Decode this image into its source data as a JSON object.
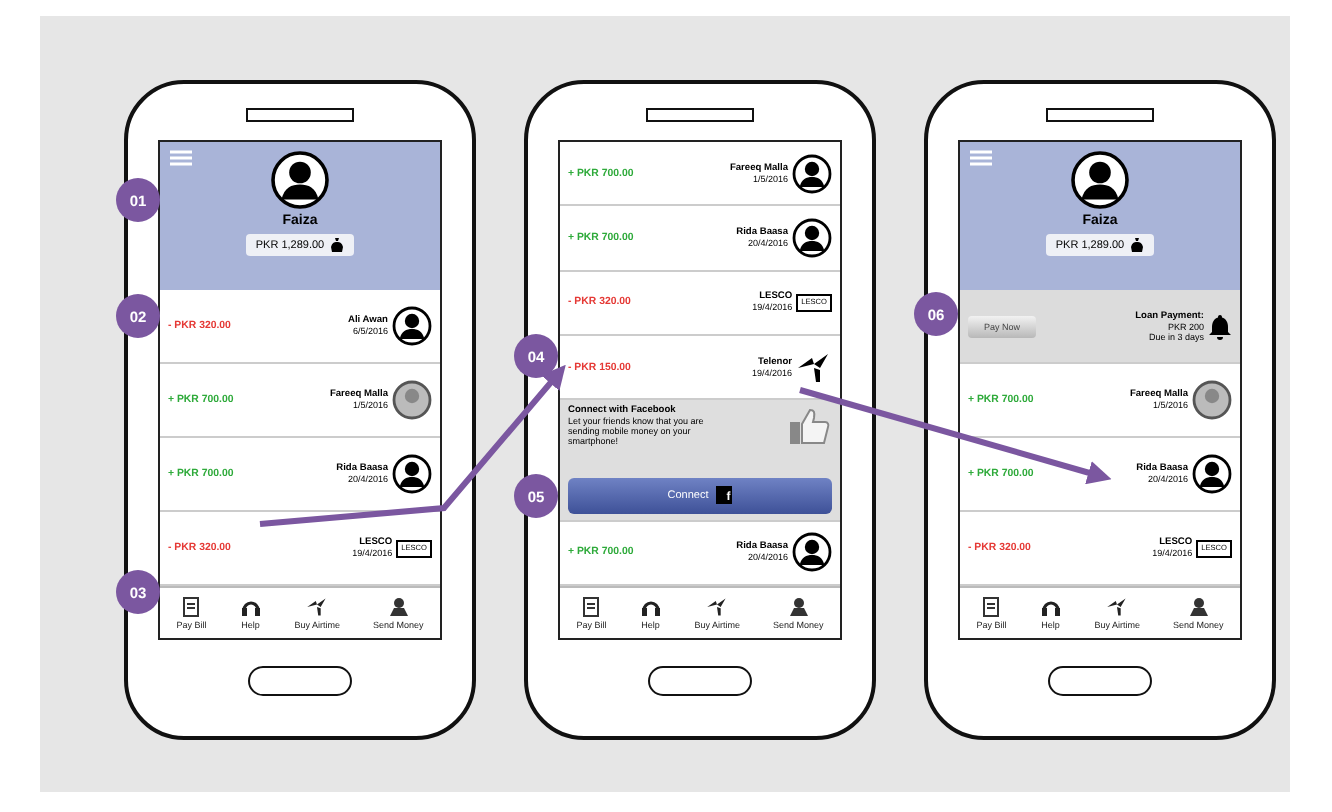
{
  "phones": [
    {
      "screen": [
        {
          "kind": "profile_header",
          "name": "Faiza",
          "balance": "PKR 1,289.00"
        },
        {
          "kind": "transaction",
          "amount": "- PKR 320.00",
          "color": "#e53935",
          "name": "Ali Awan",
          "date": "6/5/2016",
          "avatar": {
            "kind": "silhouette"
          }
        },
        {
          "kind": "transaction",
          "amount": "+ PKR 700.00",
          "color": "#2eaa3a",
          "name": "Fareeq Malla",
          "date": "1/5/2016",
          "avatar": {
            "kind": "photo"
          }
        },
        {
          "kind": "transaction",
          "amount": "+ PKR 700.00",
          "color": "#2eaa3a",
          "name": "Rida Baasa",
          "date": "20/4/2016",
          "avatar": {
            "kind": "silhouette"
          }
        },
        {
          "kind": "transaction",
          "amount": "- PKR 320.00",
          "color": "#e53935",
          "name": "LESCO",
          "date": "19/4/2016",
          "avatar": {
            "kind": "logo",
            "text": "LESCO"
          }
        }
      ],
      "nav": [
        {
          "label": "Pay Bill"
        },
        {
          "label": "Help"
        },
        {
          "label": "Buy Airtime"
        },
        {
          "label": "Send Money"
        }
      ]
    },
    {
      "screen": [
        {
          "kind": "transaction",
          "amount": "+ PKR 700.00",
          "color": "#2eaa3a",
          "name": "Fareeq Malla",
          "date": "1/5/2016",
          "avatar": {
            "kind": "silhouette"
          }
        },
        {
          "kind": "transaction",
          "amount": "+ PKR 700.00",
          "color": "#2eaa3a",
          "name": "Rida Baasa",
          "date": "20/4/2016",
          "avatar": {
            "kind": "silhouette"
          }
        },
        {
          "kind": "transaction",
          "amount": "- PKR 320.00",
          "color": "#e53935",
          "name": "LESCO",
          "date": "19/4/2016",
          "avatar": {
            "kind": "logo",
            "text": "LESCO"
          }
        },
        {
          "kind": "transaction",
          "amount": "- PKR 150.00",
          "color": "#e53935",
          "name": "Telenor",
          "date": "19/4/2016",
          "avatar": {
            "kind": "telenor"
          }
        },
        {
          "kind": "facebook_card",
          "title": "Connect with Facebook",
          "text": "Let your friends know that you are sending mobile money on your smartphone!",
          "button": "Connect",
          "button_icon": "f"
        },
        {
          "kind": "transaction",
          "amount": "+ PKR 700.00",
          "color": "#2eaa3a",
          "name": "Rida Baasa",
          "date": "20/4/2016",
          "avatar": {
            "kind": "silhouette"
          }
        }
      ],
      "nav": [
        {
          "label": "Pay Bill"
        },
        {
          "label": "Help"
        },
        {
          "label": "Buy Airtime"
        },
        {
          "label": "Send Money"
        }
      ]
    },
    {
      "screen": [
        {
          "kind": "profile_header",
          "name": "Faiza",
          "balance": "PKR 1,289.00"
        },
        {
          "kind": "loan_reminder",
          "button": "Pay Now",
          "title": "Loan Payment:",
          "amount": "PKR 200",
          "due": "Due in 3 days"
        },
        {
          "kind": "transaction",
          "amount": "+ PKR 700.00",
          "color": "#2eaa3a",
          "name": "Fareeq Malla",
          "date": "1/5/2016",
          "avatar": {
            "kind": "photo"
          }
        },
        {
          "kind": "transaction",
          "amount": "+ PKR 700.00",
          "color": "#2eaa3a",
          "name": "Rida Baasa",
          "date": "20/4/2016",
          "avatar": {
            "kind": "silhouette"
          }
        },
        {
          "kind": "transaction",
          "amount": "- PKR 320.00",
          "color": "#e53935",
          "name": "LESCO",
          "date": "19/4/2016",
          "avatar": {
            "kind": "logo",
            "text": "LESCO"
          }
        }
      ],
      "nav": [
        {
          "label": "Pay Bill"
        },
        {
          "label": "Help"
        },
        {
          "label": "Buy Airtime"
        },
        {
          "label": "Send Money"
        }
      ]
    }
  ],
  "annotations": [
    {
      "number": "01"
    },
    {
      "number": "02"
    },
    {
      "number": "03"
    },
    {
      "number": "04"
    },
    {
      "number": "05"
    },
    {
      "number": "06"
    }
  ]
}
